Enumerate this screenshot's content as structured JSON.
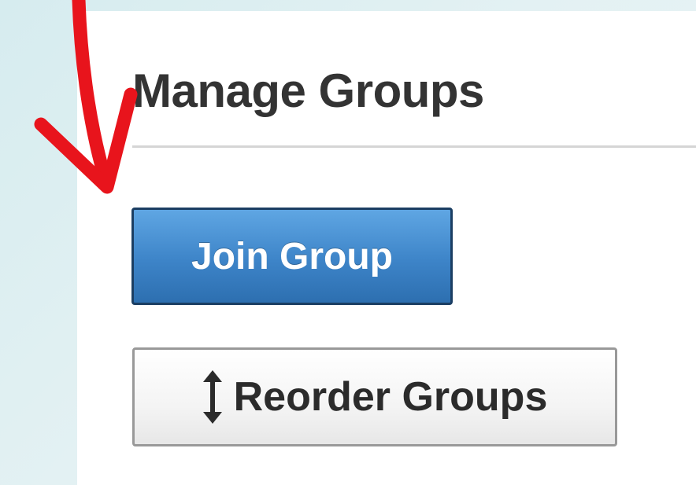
{
  "page": {
    "title": "Manage Groups"
  },
  "actions": {
    "join_label": "Join Group",
    "reorder_label": "Reorder Groups"
  },
  "icons": {
    "reorder": "vertical-resize-arrows-icon",
    "annotation": "red-curved-arrow"
  },
  "colors": {
    "primary_button": "#3d84c8",
    "primary_button_border": "#1b3e63",
    "secondary_button": "#f4f4f4",
    "secondary_button_border": "#999999",
    "annotation_arrow": "#e8141c",
    "title_text": "#333333"
  }
}
